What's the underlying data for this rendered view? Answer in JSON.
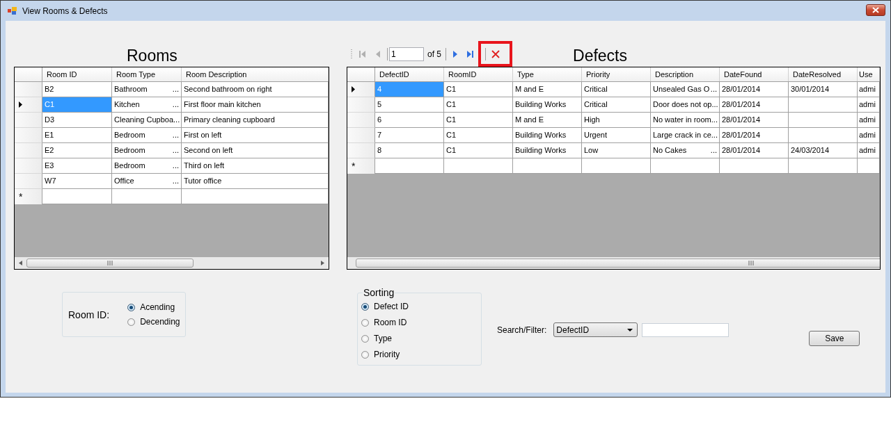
{
  "window": {
    "title": "View Rooms & Defects"
  },
  "rooms": {
    "title": "Rooms",
    "columns": [
      "Room ID",
      "Room Type",
      "Room Description"
    ],
    "rows": [
      {
        "selected": false,
        "cells": [
          {
            "text": "B2"
          },
          {
            "text": "Bathroom",
            "ellipsis": "..."
          },
          {
            "text": "Second bathroom on right"
          }
        ]
      },
      {
        "selected": true,
        "cells": [
          {
            "text": "C1"
          },
          {
            "text": "Kitchen",
            "ellipsis": "..."
          },
          {
            "text": "First floor main kitchen"
          }
        ]
      },
      {
        "selected": false,
        "cells": [
          {
            "text": "D3"
          },
          {
            "text": "Cleaning Cupboa",
            "ellipsis": "..."
          },
          {
            "text": "Primary cleaning cupboard"
          }
        ]
      },
      {
        "selected": false,
        "cells": [
          {
            "text": "E1"
          },
          {
            "text": "Bedroom",
            "ellipsis": "..."
          },
          {
            "text": "First on left"
          }
        ]
      },
      {
        "selected": false,
        "cells": [
          {
            "text": "E2"
          },
          {
            "text": "Bedroom",
            "ellipsis": "..."
          },
          {
            "text": "Second on left"
          }
        ]
      },
      {
        "selected": false,
        "cells": [
          {
            "text": "E3"
          },
          {
            "text": "Bedroom",
            "ellipsis": "..."
          },
          {
            "text": "Third on left"
          }
        ]
      },
      {
        "selected": false,
        "cells": [
          {
            "text": "W7"
          },
          {
            "text": "Office",
            "ellipsis": "..."
          },
          {
            "text": "Tutor office"
          }
        ]
      }
    ],
    "new_row_marker": "*"
  },
  "navigator": {
    "page": "1",
    "of": "of 5",
    "delete_highlighted": true
  },
  "defects": {
    "title": "Defects",
    "columns": [
      "DefectID",
      "RoomID",
      "Type",
      "Priority",
      "Description",
      "DateFound",
      "DateResolved",
      "Use"
    ],
    "rows": [
      {
        "selected": true,
        "cells": [
          {
            "text": "4"
          },
          {
            "text": "C1"
          },
          {
            "text": "M and E"
          },
          {
            "text": "Critical"
          },
          {
            "text": "Unsealed Gas O",
            "ellipsis": "..."
          },
          {
            "text": "28/01/2014"
          },
          {
            "text": "30/01/2014"
          },
          {
            "text": "admi"
          }
        ]
      },
      {
        "selected": false,
        "cells": [
          {
            "text": "5"
          },
          {
            "text": "C1"
          },
          {
            "text": "Building Works"
          },
          {
            "text": "Critical"
          },
          {
            "text": "Door does not op",
            "ellipsis": "..."
          },
          {
            "text": "28/01/2014"
          },
          {
            "text": ""
          },
          {
            "text": "admi"
          }
        ]
      },
      {
        "selected": false,
        "cells": [
          {
            "text": "6"
          },
          {
            "text": "C1"
          },
          {
            "text": "M and E"
          },
          {
            "text": "High"
          },
          {
            "text": "No water in room",
            "ellipsis": "..."
          },
          {
            "text": "28/01/2014"
          },
          {
            "text": ""
          },
          {
            "text": "admi"
          }
        ]
      },
      {
        "selected": false,
        "cells": [
          {
            "text": "7"
          },
          {
            "text": "C1"
          },
          {
            "text": "Building Works"
          },
          {
            "text": "Urgent"
          },
          {
            "text": "Large crack in ce",
            "ellipsis": "..."
          },
          {
            "text": "28/01/2014"
          },
          {
            "text": ""
          },
          {
            "text": "admi"
          }
        ]
      },
      {
        "selected": false,
        "cells": [
          {
            "text": "8"
          },
          {
            "text": "C1"
          },
          {
            "text": "Building Works"
          },
          {
            "text": "Low"
          },
          {
            "text": "No Cakes",
            "ellipsis": "..."
          },
          {
            "text": "28/01/2014"
          },
          {
            "text": "24/03/2014"
          },
          {
            "text": "admi"
          }
        ]
      }
    ],
    "new_row_marker": "*"
  },
  "room_sort": {
    "label": "Room ID:",
    "options": [
      {
        "label": "Acending",
        "selected": true
      },
      {
        "label": "Decending",
        "selected": false
      }
    ]
  },
  "sorting": {
    "title": "Sorting",
    "options": [
      {
        "label": "Defect ID",
        "selected": true
      },
      {
        "label": "Room ID",
        "selected": false
      },
      {
        "label": "Type",
        "selected": false
      },
      {
        "label": "Priority",
        "selected": false
      }
    ]
  },
  "search": {
    "label": "Search/Filter:",
    "field": "DefectID"
  },
  "save_button": "Save"
}
